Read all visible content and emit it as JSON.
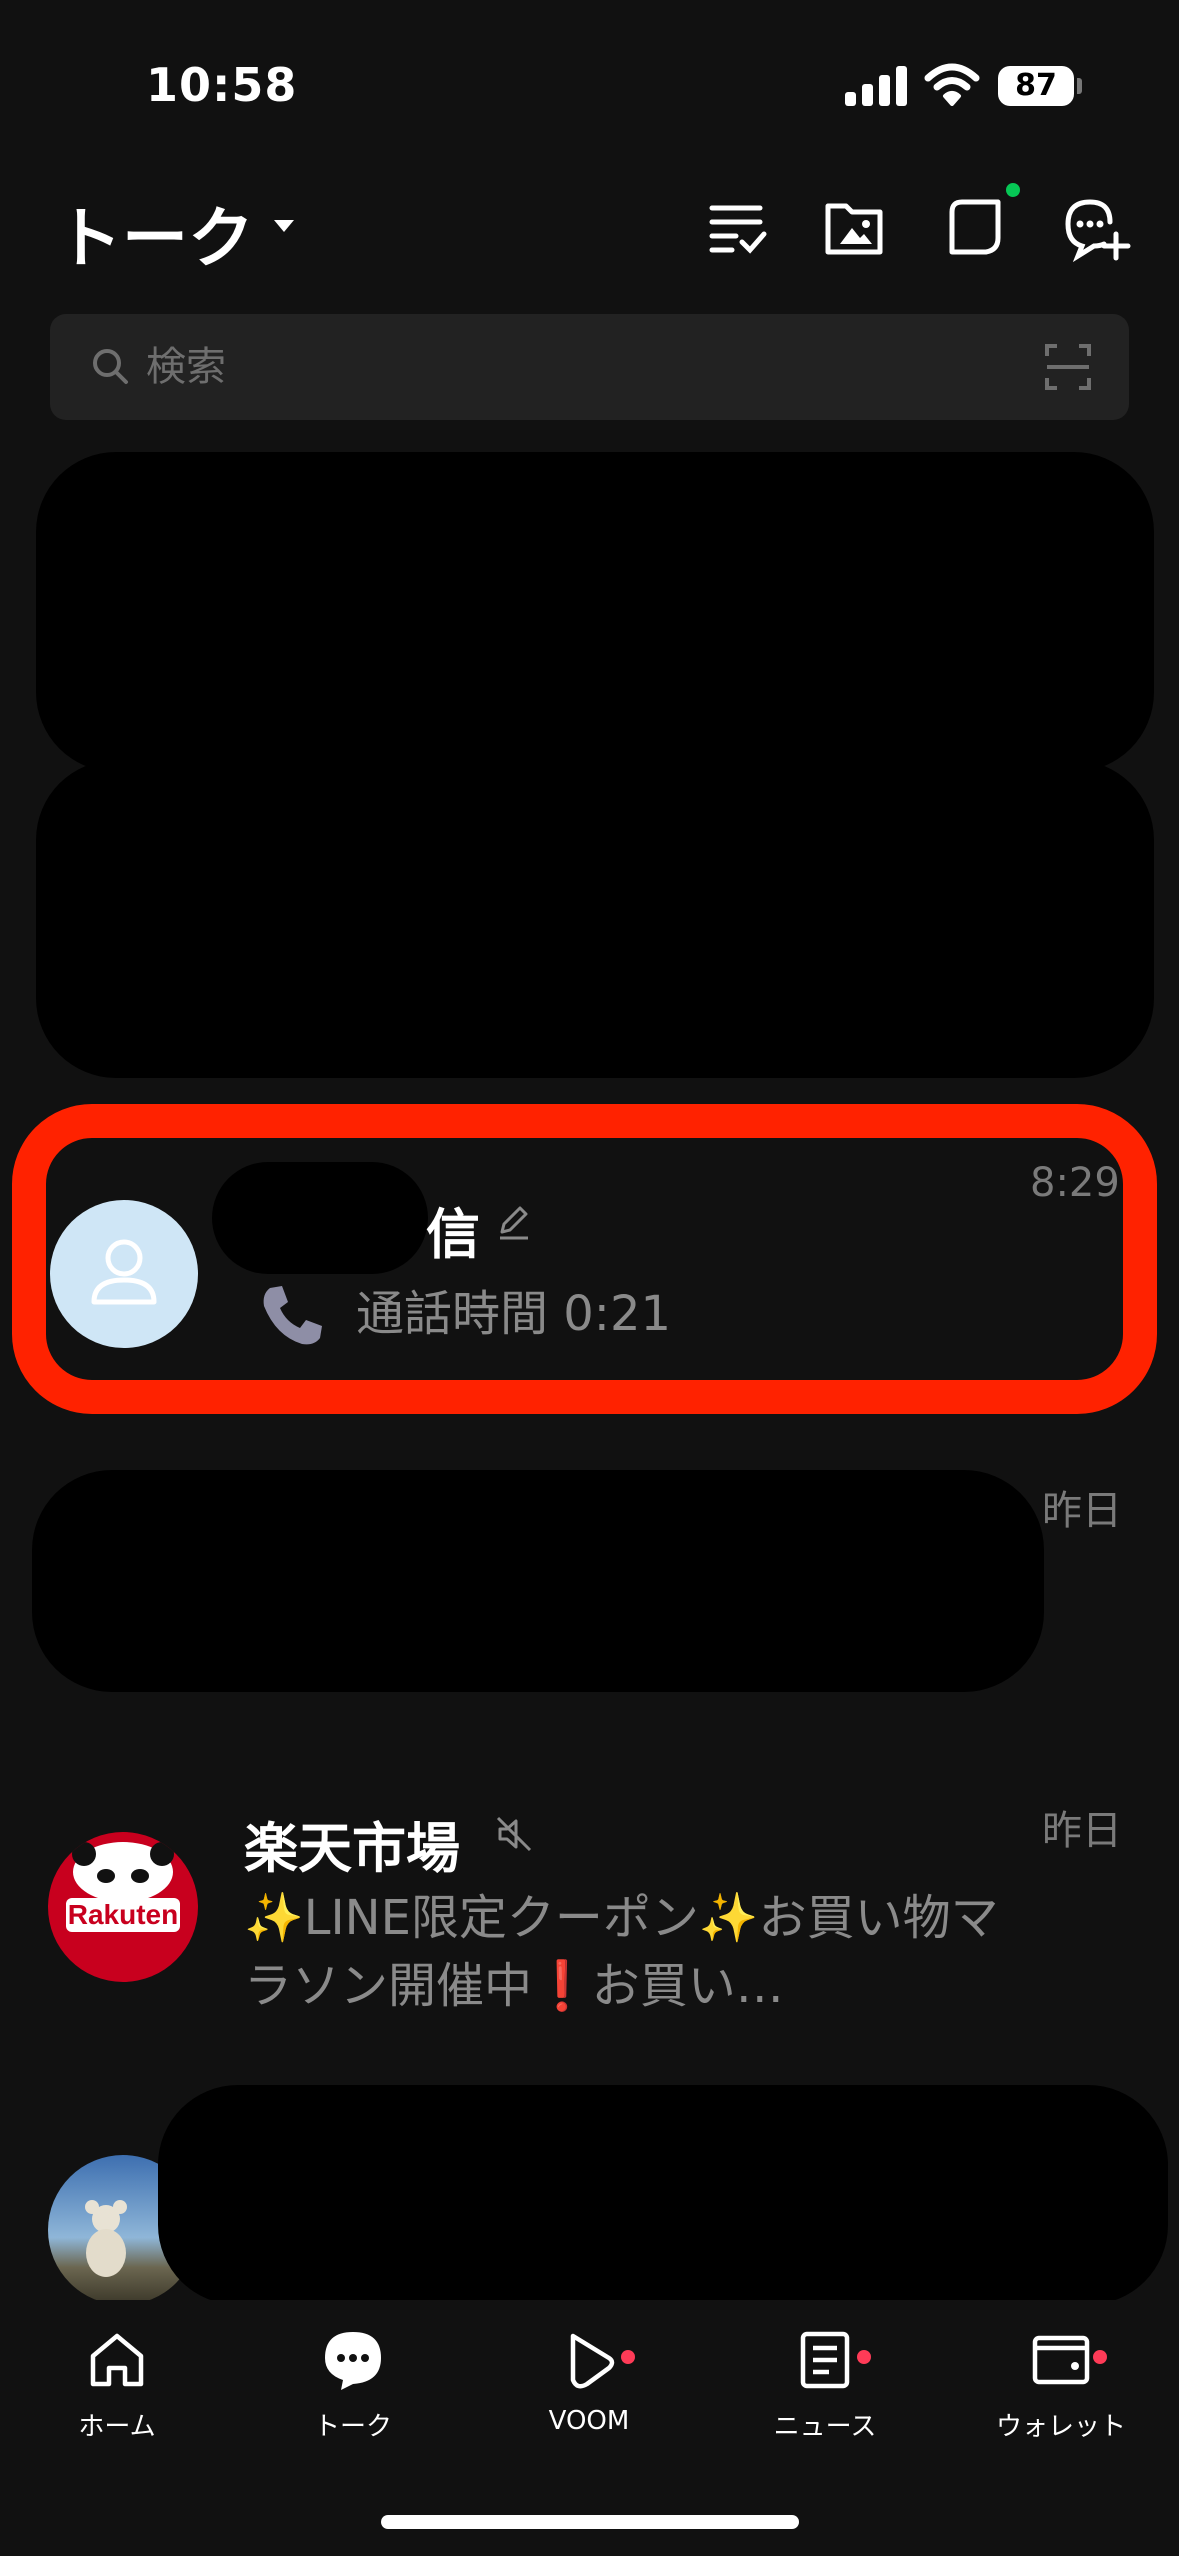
{
  "status_bar": {
    "time": "10:58",
    "battery": "87"
  },
  "header": {
    "title": "トーク",
    "icons": [
      "edit-list-icon",
      "photo-folder-icon",
      "square-chat-icon",
      "new-chat-icon"
    ],
    "badge_color": "#06c755"
  },
  "search": {
    "placeholder": "検索"
  },
  "chats": [
    {
      "name_visible": "信",
      "preview": "通話時間 0:21",
      "time": "8:29",
      "avatar": "default-person-icon",
      "highlighted": true
    },
    {
      "time": "昨日"
    },
    {
      "name": "楽天市場",
      "muted": true,
      "preview": "✨LINE限定クーポン✨お買い物マラソン開催中❗お買い…",
      "time": "昨日",
      "avatar_text": "Rakuten"
    }
  ],
  "tabs": [
    {
      "label": "ホーム",
      "icon": "home-icon",
      "dot": false
    },
    {
      "label": "トーク",
      "icon": "talk-icon",
      "dot": false,
      "active": true
    },
    {
      "label": "VOOM",
      "icon": "voom-icon",
      "dot": true
    },
    {
      "label": "ニュース",
      "icon": "news-icon",
      "dot": true
    },
    {
      "label": "ウォレット",
      "icon": "wallet-icon",
      "dot": true
    }
  ],
  "colors": {
    "accent_red": "#ff2200",
    "notification": "#ff3b57",
    "background": "#111111"
  }
}
